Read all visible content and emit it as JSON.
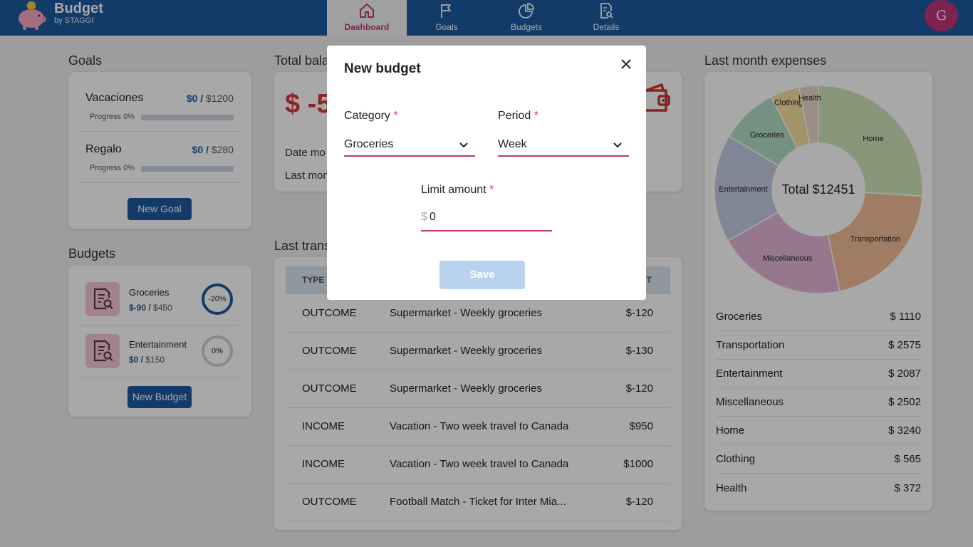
{
  "brand": {
    "title": "Budget",
    "subtitle": "by STAGGI"
  },
  "nav": [
    {
      "label": "Dashboard",
      "icon": "home-icon",
      "active": true
    },
    {
      "label": "Goals",
      "icon": "flag-icon",
      "active": false
    },
    {
      "label": "Budgets",
      "icon": "pie-chart-icon",
      "active": false
    },
    {
      "label": "Details",
      "icon": "document-search-icon",
      "active": false
    }
  ],
  "user": {
    "initial": "G"
  },
  "goals": {
    "title": "Goals",
    "items": [
      {
        "name": "Vacaciones",
        "current": "$0 /",
        "target": " $1200",
        "progress_label": "Progress 0%",
        "progress": 0
      },
      {
        "name": "Regalo",
        "current": "$0 /",
        "target": " $280",
        "progress_label": "Progress 0%",
        "progress": 0
      }
    ],
    "new_button": "New Goal"
  },
  "budgets": {
    "title": "Budgets",
    "items": [
      {
        "name": "Groceries",
        "current": "$-90 /",
        "limit": " $450",
        "percent_label": "-20%",
        "percent": -20,
        "ring_color": "#1e5aa0"
      },
      {
        "name": "Entertainment",
        "current": "$0 /",
        "limit": " $150",
        "percent_label": "0%",
        "percent": 0,
        "ring_color": "#d0d0d0"
      }
    ],
    "new_button": "New Budget"
  },
  "balance": {
    "title": "Total bala",
    "amount": "$ -5",
    "line1": "Date mo",
    "line2": "Last mon",
    "icon": "wallet-icon"
  },
  "transactions": {
    "title": "Last trans",
    "headers": {
      "type": "TYPE",
      "amount": "NT"
    },
    "rows": [
      {
        "type": "OUTCOME",
        "desc": "Supermarket - Weekly groceries",
        "amount": "$-120"
      },
      {
        "type": "OUTCOME",
        "desc": "Supermarket - Weekly groceries",
        "amount": "$-130"
      },
      {
        "type": "OUTCOME",
        "desc": "Supermarket - Weekly groceries",
        "amount": "$-120"
      },
      {
        "type": "INCOME",
        "desc": "Vacation - Two week travel to Canada",
        "amount": "$950"
      },
      {
        "type": "INCOME",
        "desc": "Vacation - Two week travel to Canada",
        "amount": "$1000"
      },
      {
        "type": "OUTCOME",
        "desc": "Football Match - Ticket for Inter Mia...",
        "amount": "$-120"
      }
    ]
  },
  "expenses": {
    "title": "Last month expenses",
    "total_label": "Total $12451",
    "rows": [
      {
        "name": "Groceries",
        "value": "$ 1110"
      },
      {
        "name": "Transportation",
        "value": "$ 2575"
      },
      {
        "name": "Entertainment",
        "value": "$ 2087"
      },
      {
        "name": "Miscellaneous",
        "value": "$ 2502"
      },
      {
        "name": "Home",
        "value": "$ 3240"
      },
      {
        "name": "Clothing",
        "value": "$ 565"
      },
      {
        "name": "Health",
        "value": "$ 372"
      }
    ]
  },
  "chart_data": {
    "type": "pie",
    "donut": true,
    "center_label": "Total $12451",
    "slices": [
      {
        "label": "Home",
        "value": 3240,
        "color": "#cfe6b8"
      },
      {
        "label": "Transportation",
        "value": 2575,
        "color": "#f4bc9a"
      },
      {
        "label": "Miscellaneous",
        "value": 2502,
        "color": "#e3b6d8"
      },
      {
        "label": "Entertainment",
        "value": 2087,
        "color": "#c3cbe3"
      },
      {
        "label": "Groceries",
        "value": 1110,
        "color": "#b2dcc6"
      },
      {
        "label": "Clothing",
        "value": 565,
        "color": "#f8e3a0"
      },
      {
        "label": "Health",
        "value": 372,
        "color": "#ead8cc"
      }
    ]
  },
  "modal": {
    "title": "New budget",
    "category_label": "Category",
    "category_value": "Groceries",
    "period_label": "Period",
    "period_value": "Week",
    "required_mark": "*",
    "limit_label": "Limit amount",
    "currency": "$",
    "limit_value": "0",
    "save_label": "Save"
  }
}
